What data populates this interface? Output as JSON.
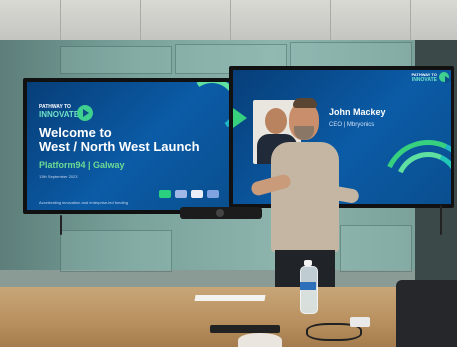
{
  "left_screen": {
    "logo_line1": "PATHWAY TO",
    "logo_line2": "INNOVATE",
    "title_line1": "Welcome to",
    "title_line2": "West / North West Launch",
    "subtitle": "Platform94 | Galway",
    "date_text": "13th September 2023",
    "footer_text": "Accelerating innovation and enterprise-led funding"
  },
  "right_screen": {
    "logo_line1": "PATHWAY TO",
    "logo_line2": "INNOVATE",
    "speaker_name": "John Mackey",
    "speaker_role": "CEO | Mbryonics"
  },
  "colors": {
    "slide_blue": "#0b5ba6",
    "accent_green": "#6ddc93",
    "accent_teal": "#6fe1c7"
  }
}
